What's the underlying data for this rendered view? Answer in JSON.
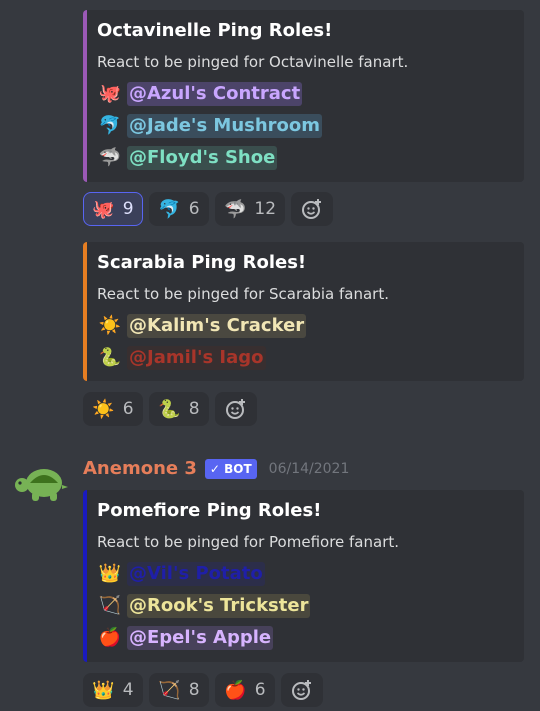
{
  "messages": [
    {
      "embed": {
        "color": "#9b59b6",
        "title": "Octavinelle Ping Roles!",
        "description": "React to be pinged for Octavinelle fanart.",
        "roles": [
          {
            "emoji": "🐙",
            "emoji_name": "octopus-icon",
            "mention": "@Azul's Contract",
            "color": "#c9a6ff",
            "bg": "#4c4469"
          },
          {
            "emoji": "🐬",
            "emoji_name": "dolphin-icon",
            "mention": "@Jade's Mushroom",
            "color": "#7cc7e0",
            "bg": "#3a4d5c"
          },
          {
            "emoji": "🦈",
            "emoji_name": "shark-icon",
            "mention": "@Floyd's Shoe",
            "color": "#7ee0c3",
            "bg": "#3a4e4d"
          }
        ]
      },
      "reactions": [
        {
          "emoji": "🐙",
          "emoji_name": "octopus-icon",
          "count": "9",
          "active": true
        },
        {
          "emoji": "🐬",
          "emoji_name": "dolphin-icon",
          "count": "6",
          "active": false
        },
        {
          "emoji": "🦈",
          "emoji_name": "shark-icon",
          "count": "12",
          "active": false
        }
      ]
    },
    {
      "embed": {
        "color": "#e67e22",
        "title": "Scarabia Ping Roles!",
        "description": "React to be pinged for Scarabia fanart.",
        "roles": [
          {
            "emoji": "☀️",
            "emoji_name": "sun-icon",
            "mention": "@Kalim's Cracker",
            "color": "#f1e6b5",
            "bg": "#4a4840"
          },
          {
            "emoji": "🐍",
            "emoji_name": "snake-icon",
            "mention": "@Jamil's Iago",
            "color": "#a8352a",
            "bg": "#382f30"
          }
        ]
      },
      "reactions": [
        {
          "emoji": "☀️",
          "emoji_name": "sun-icon",
          "count": "6",
          "active": false
        },
        {
          "emoji": "🐍",
          "emoji_name": "snake-icon",
          "count": "8",
          "active": false
        }
      ]
    },
    {
      "author": {
        "name": "Anemone 3",
        "bot_tag": "✓ BOT",
        "timestamp": "06/14/2021",
        "avatar_emoji": "🐢"
      },
      "embed": {
        "color": "#1a1abf",
        "title": "Pomefiore Ping Roles!",
        "description": "React to be pinged for Pomefiore fanart.",
        "roles": [
          {
            "emoji": "👑",
            "emoji_name": "crown-icon",
            "mention": "@Vil's Potato",
            "color": "#1f1fa8",
            "bg": "#2c2e4a"
          },
          {
            "emoji": "🏹",
            "emoji_name": "bow-and-arrow-icon",
            "mention": "@Rook's Trickster",
            "color": "#ede59a",
            "bg": "#4a483d"
          },
          {
            "emoji": "🍎",
            "emoji_name": "apple-icon",
            "mention": "@Epel's Apple",
            "color": "#d7b3ff",
            "bg": "#47415a"
          }
        ]
      },
      "reactions": [
        {
          "emoji": "👑",
          "emoji_name": "crown-icon",
          "count": "4",
          "active": false
        },
        {
          "emoji": "🏹",
          "emoji_name": "bow-and-arrow-icon",
          "count": "8",
          "active": false
        },
        {
          "emoji": "🍎",
          "emoji_name": "apple-icon",
          "count": "6",
          "active": false
        }
      ]
    }
  ],
  "add_reaction_icon": "add-reaction-icon"
}
